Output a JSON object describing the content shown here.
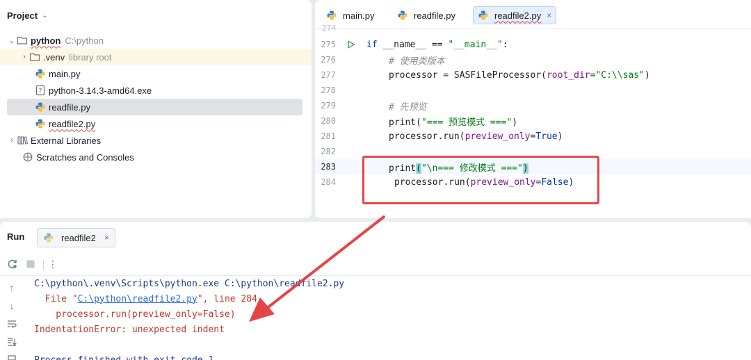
{
  "project_panel": {
    "title": "Project",
    "tree": [
      {
        "name": "python",
        "hint": "C:\\python"
      },
      {
        "name": ".venv",
        "hint": "library root"
      },
      {
        "name": "main.py",
        "hint": ""
      },
      {
        "name": "python-3.14.3-amd64.exe",
        "hint": ""
      },
      {
        "name": "readfile.py",
        "hint": ""
      },
      {
        "name": "readfile2.py",
        "hint": ""
      },
      {
        "name": "External Libraries",
        "hint": ""
      },
      {
        "name": "Scratches and Consoles",
        "hint": ""
      }
    ]
  },
  "editor": {
    "tabs": [
      {
        "label": "main.py"
      },
      {
        "label": "readfile.py"
      },
      {
        "label": "readfile2.py",
        "close": "×"
      }
    ],
    "partial_line_number": "274",
    "lines": [
      {
        "num": "275",
        "parts": [
          "if ",
          "__name__",
          " == ",
          "\"__main__\"",
          ":"
        ]
      },
      {
        "num": "276",
        "parts": [
          "# 使用类版本"
        ]
      },
      {
        "num": "277",
        "parts": [
          "processor = SASFileProcessor(",
          "root_dir",
          "=",
          "\"C:\\\\sas\"",
          ")"
        ]
      },
      {
        "num": "278",
        "parts": []
      },
      {
        "num": "279",
        "parts": [
          "# 先预览"
        ]
      },
      {
        "num": "280",
        "parts": [
          "print(",
          "\"=== 预览模式 ===\"",
          ")"
        ]
      },
      {
        "num": "281",
        "parts": [
          "processor.run(",
          "preview_only",
          "=",
          "True",
          ")"
        ]
      },
      {
        "num": "282",
        "parts": []
      },
      {
        "num": "283",
        "parts": [
          "print",
          "(",
          "\"\\n=== 修改模式 ===\"",
          ")"
        ]
      },
      {
        "num": "284",
        "parts": [
          "processor.run(",
          "preview_only",
          "=",
          "False",
          ")"
        ]
      }
    ]
  },
  "run_panel": {
    "title": "Run",
    "tab_label": "readfile2",
    "tab_close": "×",
    "console": [
      "C:\\python\\.venv\\Scripts\\python.exe C:\\python\\readfile2.py",
      "  File \"",
      "C:\\python\\readfile2.py",
      "\", line 284",
      "    processor.run(preview_only=False)",
      "IndentationError: unexpected indent",
      "Process finished with exit code 1"
    ]
  },
  "colors": {
    "annotation_red": "#e64545",
    "keyword_blue": "#0033b3",
    "string_green": "#067d17",
    "error_red": "#c0392b"
  }
}
